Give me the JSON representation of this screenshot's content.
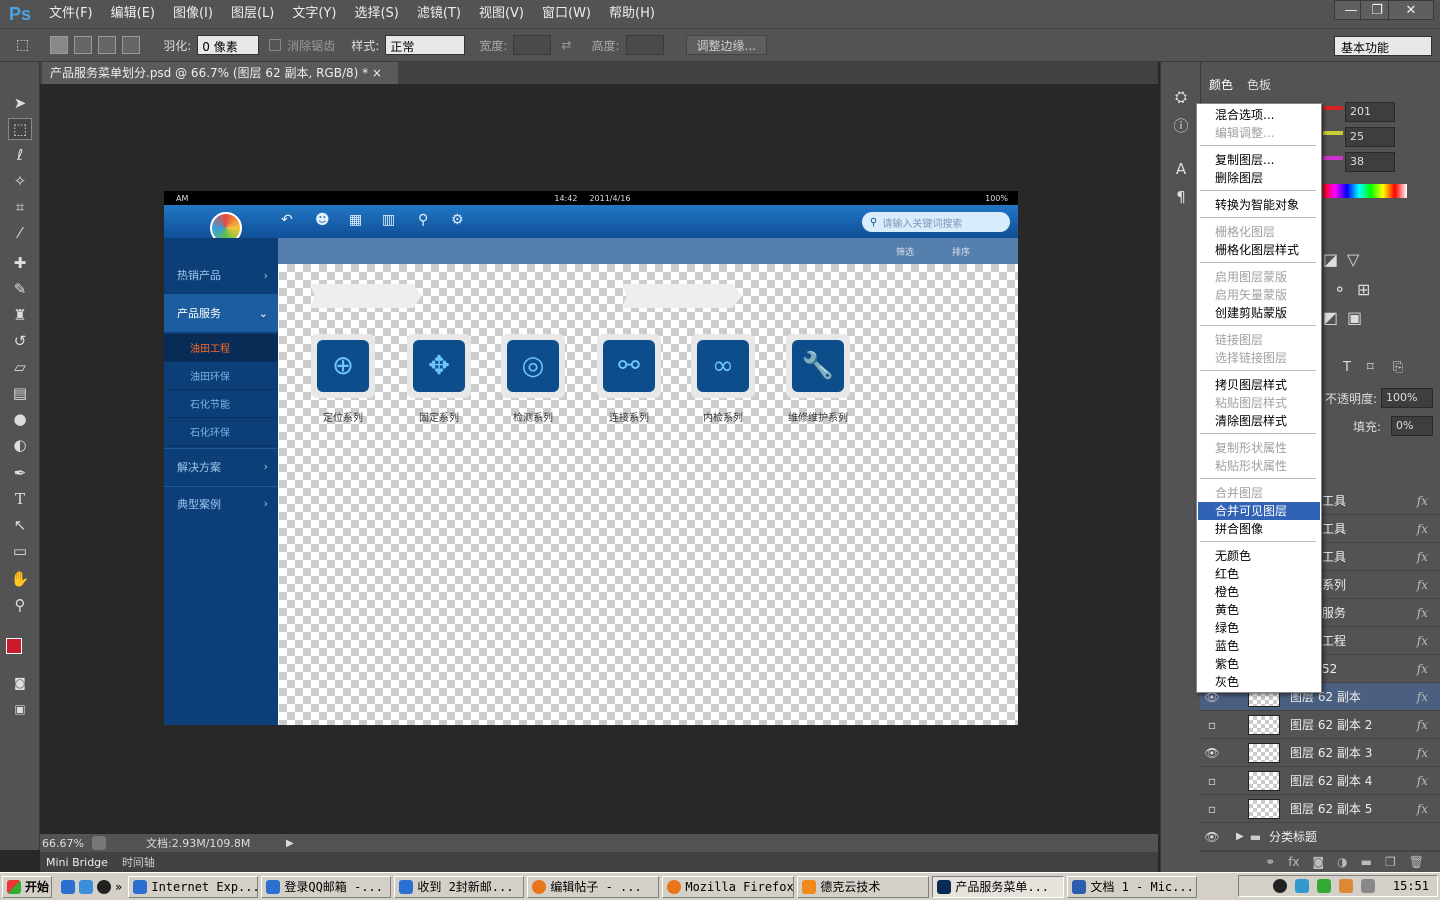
{
  "app": {
    "logo": "Ps"
  },
  "menu": [
    "文件(F)",
    "编辑(E)",
    "图像(I)",
    "图层(L)",
    "文字(Y)",
    "选择(S)",
    "滤镜(T)",
    "视图(V)",
    "窗口(W)",
    "帮助(H)"
  ],
  "window_controls": {
    "minimize": "—",
    "restore": "❐",
    "close": "✕"
  },
  "options": {
    "feather_label": "羽化:",
    "feather_value": "0 像素",
    "antialias_label": "消除锯齿",
    "style_label": "样式:",
    "style_value": "正常",
    "width_label": "宽度:",
    "height_label": "高度:",
    "refine_edge": "调整边缘...",
    "workspace": "基本功能"
  },
  "document_tab": "产品服务菜单划分.psd @ 66.7% (图层 62 副本, RGB/8) * ×",
  "status": {
    "zoom": "66.67%",
    "doc_size": "文档:2.93M/109.8M"
  },
  "bottom_tabs": [
    "Mini Bridge",
    "时间轴"
  ],
  "color_panel": {
    "tab_color": "颜色",
    "tab_swatches": "色板",
    "r": "201",
    "g": "25",
    "b": "38"
  },
  "layers_panel": {
    "opacity_label": "不透明度:",
    "opacity_value": "100%",
    "fill_label": "填充:",
    "fill_value": "0%"
  },
  "layers_partial": [
    "工具",
    "工具",
    "工具",
    "系列",
    "服务",
    "工程",
    "52"
  ],
  "layers": [
    {
      "name": "图层 62 副本",
      "visible": true,
      "selected": true
    },
    {
      "name": "图层 62 副本 2",
      "visible": false,
      "selected": false
    },
    {
      "name": "图层 62 副本 3",
      "visible": true,
      "selected": false
    },
    {
      "name": "图层 62 副本 4",
      "visible": false,
      "selected": false
    },
    {
      "name": "图层 62 副本 5",
      "visible": false,
      "selected": false
    }
  ],
  "layer_group": "分类标题",
  "context_menu": [
    {
      "label": "混合选项...",
      "disabled": false
    },
    {
      "label": "编辑调整...",
      "disabled": true
    },
    {
      "sep": true
    },
    {
      "label": "复制图层...",
      "disabled": false
    },
    {
      "label": "删除图层",
      "disabled": false
    },
    {
      "sep": true
    },
    {
      "label": "转换为智能对象",
      "disabled": false
    },
    {
      "sep": true
    },
    {
      "label": "栅格化图层",
      "disabled": true
    },
    {
      "label": "栅格化图层样式",
      "disabled": false
    },
    {
      "sep": true
    },
    {
      "label": "启用图层蒙版",
      "disabled": true
    },
    {
      "label": "启用矢量蒙版",
      "disabled": true
    },
    {
      "label": "创建剪贴蒙版",
      "disabled": false
    },
    {
      "sep": true
    },
    {
      "label": "链接图层",
      "disabled": true
    },
    {
      "label": "选择链接图层",
      "disabled": true
    },
    {
      "sep": true
    },
    {
      "label": "拷贝图层样式",
      "disabled": false
    },
    {
      "label": "粘贴图层样式",
      "disabled": true
    },
    {
      "label": "清除图层样式",
      "disabled": false
    },
    {
      "sep": true
    },
    {
      "label": "复制形状属性",
      "disabled": true
    },
    {
      "label": "粘贴形状属性",
      "disabled": true
    },
    {
      "sep": true
    },
    {
      "label": "合并图层",
      "disabled": true
    },
    {
      "label": "合并可见图层",
      "disabled": false,
      "highlighted": true
    },
    {
      "label": "拼合图像",
      "disabled": false
    },
    {
      "sep": true
    },
    {
      "label": "无颜色",
      "disabled": false
    },
    {
      "label": "红色",
      "disabled": false
    },
    {
      "label": "橙色",
      "disabled": false
    },
    {
      "label": "黄色",
      "disabled": false
    },
    {
      "label": "绿色",
      "disabled": false
    },
    {
      "label": "蓝色",
      "disabled": false
    },
    {
      "label": "紫色",
      "disabled": false
    },
    {
      "label": "灰色",
      "disabled": false
    }
  ],
  "doc_design": {
    "statusbar_left": "AM",
    "statusbar_time": "14:42",
    "statusbar_date": "2011/4/16",
    "statusbar_battery": "100%",
    "search_placeholder": "请输入关键词搜索",
    "filter": "筛选",
    "sort": "排序",
    "sidebar": [
      "热销产品",
      "产品服务",
      "解决方案",
      "典型案例"
    ],
    "sub_items": [
      "油田工程",
      "油田环保",
      "石化节能",
      "石化环保"
    ],
    "products": [
      "定位系列",
      "固定系列",
      "检测系列",
      "连接系列",
      "内检系列",
      "维修维护系列"
    ]
  },
  "taskbar": {
    "start": "开始",
    "quick": "»",
    "tasks": [
      "Internet Exp...",
      "登录QQ邮箱 -...",
      "收到 2封新邮...",
      "编辑帖子 - ...",
      "Mozilla Firefox",
      "德克云技术",
      "产品服务菜单...",
      "文档 1 - Mic..."
    ],
    "clock": "15:51"
  }
}
